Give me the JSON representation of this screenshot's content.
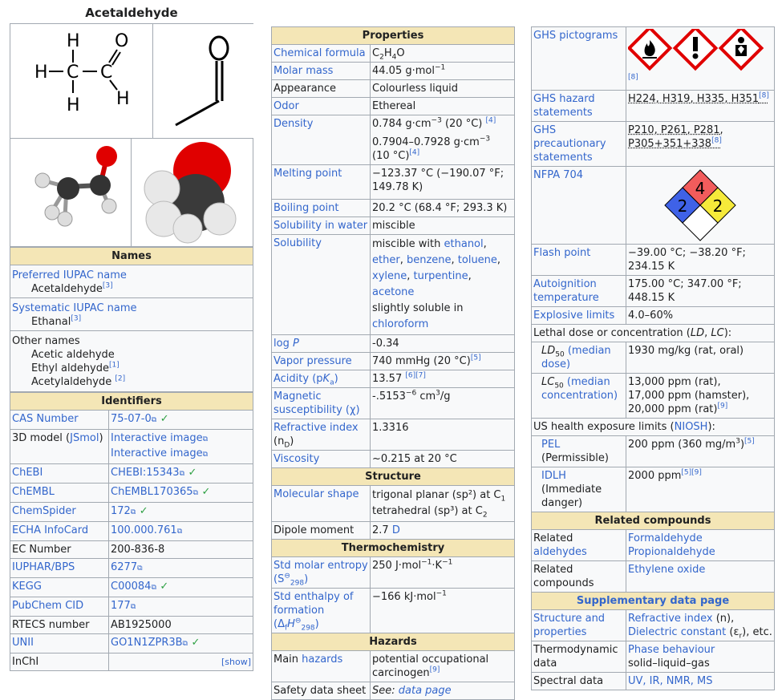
{
  "title": "Acetaldehyde",
  "names": {
    "header": "Names",
    "preferred_label": "Preferred IUPAC name",
    "preferred_value": "Acetaldehyde",
    "preferred_ref": "[3]",
    "systematic_label": "Systematic IUPAC name",
    "systematic_value": "Ethanal",
    "systematic_ref": "[3]",
    "other_label": "Other names",
    "other": [
      {
        "text": "Acetic aldehyde",
        "ref": ""
      },
      {
        "text": "Ethyl aldehyde",
        "ref": "[1]"
      },
      {
        "text": "Acetylaldehyde ",
        "ref": "[2]"
      }
    ]
  },
  "structure_labels": {
    "h1": "H",
    "h2": "H",
    "h3": "H",
    "h4": "H",
    "c1": "C",
    "c2": "C",
    "o": "O"
  },
  "identifiers": {
    "header": "Identifiers",
    "rows": [
      {
        "label": "CAS Number",
        "value": "75-07-0",
        "link": true,
        "check": true
      },
      {
        "label": "3D model (",
        "label_link": "JSmol",
        "label_tail": ")",
        "value": "Interactive image",
        "value2": "Interactive image",
        "link": true,
        "check": false
      },
      {
        "label": "ChEBI",
        "value": "CHEBI:15343",
        "link": true,
        "check": true
      },
      {
        "label": "ChEMBL",
        "value": "ChEMBL170365",
        "link": true,
        "check": true
      },
      {
        "label": "ChemSpider",
        "value": "172",
        "link": true,
        "check": true
      },
      {
        "label": "ECHA InfoCard",
        "value": "100.000.761",
        "link": true,
        "check": false
      },
      {
        "label": "EC Number",
        "value": "200-836-8",
        "link": false,
        "check": false
      },
      {
        "label": "IUPHAR/BPS",
        "value": "6277",
        "link": true,
        "check": false
      },
      {
        "label": "KEGG",
        "value": "C00084",
        "link": true,
        "check": true
      },
      {
        "label": "PubChem CID",
        "value": "177",
        "link": true,
        "check": false
      },
      {
        "label": "RTECS number",
        "value": "AB1925000",
        "link": false,
        "check": false
      },
      {
        "label": "UNII",
        "value": "GO1N1ZPR3B",
        "link": true,
        "check": true
      },
      {
        "label": "InChI",
        "value": "[show]",
        "link": false,
        "check": false
      }
    ]
  },
  "properties": {
    "header": "Properties",
    "formula_label": "Chemical formula",
    "molar_mass_label": "Molar mass",
    "molar_mass": "44.05 g·mol",
    "appearance_label": "Appearance",
    "appearance": "Colourless liquid",
    "odor_label": "Odor",
    "odor": "Ethereal",
    "density_label": "Density",
    "density1": "0.784 g·cm",
    "density1_tail": " (20 °C) ",
    "density1_ref": "[4]",
    "density2": "0.7904–0.7928 g·cm",
    "density2_tail": "(10 °C)",
    "density2_ref": "[4]",
    "melting_label": "Melting point",
    "melting": "−123.37 °C (−190.07 °F; 149.78 K)",
    "boiling_label": "Boiling point",
    "boiling": "20.2 °C (68.4 °F; 293.3 K)",
    "sol_water_label": "Solubility in water",
    "sol_water": "miscible",
    "solubility_label": "Solubility",
    "solubility_prefix": "miscible with ",
    "solvents": [
      "ethanol",
      "ether",
      "benzene",
      "toluene",
      "xylene",
      "turpentine",
      "acetone"
    ],
    "slight_prefix": "slightly soluble in ",
    "slight_link": "chloroform",
    "logp_label": "log ",
    "logp_label_p": "P",
    "logp": "-0.34",
    "vapor_label": "Vapor pressure",
    "vapor": "740 mmHg (20 °C)",
    "vapor_ref": "[5]",
    "acidity_label": "Acidity (p",
    "acidity_k": "K",
    "acidity_a": "a",
    "acidity_close": ")",
    "acidity": "13.57 ",
    "acidity_ref": "[6][7]",
    "mag_label": "Magnetic susceptibility (χ)",
    "mag": "-.5153",
    "mag_exp": "−6",
    "mag_unit": " cm",
    "mag_unit_exp": "3",
    "mag_unit_tail": "/g",
    "refr_label": "Refractive index",
    "refr_sub_label": "(n",
    "refr_sub": "D",
    "refr_close": ")",
    "refr": "1.3316",
    "visc_label": "Viscosity",
    "visc": "~0.215 at 20 °C"
  },
  "structure": {
    "header": "Structure",
    "shape_label": "Molecular shape",
    "shape1": "trigonal planar (sp²) at C",
    "shape1_sub": "1",
    "shape2": "tetrahedral (sp³) at C",
    "shape2_sub": "2",
    "dipole_label": "Dipole moment",
    "dipole": "2.7 ",
    "dipole_unit": "D"
  },
  "thermo": {
    "header": "Thermochemistry",
    "entropy_label": "Std molar entropy (S",
    "entropy_sub": "298",
    "entropy": "250 J·mol",
    "entropy_tail": "·K",
    "enthalpy_label": "Std enthalpy of formation (Δ",
    "enthalpy_sub": "298",
    "enthalpy": "−166 kJ·mol"
  },
  "hazards": {
    "header": "Hazards",
    "main_label": "Main ",
    "main_link": "hazards",
    "main": "potential occupational carcinogen",
    "main_ref": "[9]",
    "sds_label": "Safety data sheet",
    "sds_see": "See: ",
    "sds_link": "data page"
  },
  "ghs": {
    "pict_label": "GHS pictograms",
    "pict_ref": "[8]",
    "hazard_label": "GHS hazard statements",
    "hazard": [
      "H224",
      "H319",
      "H335",
      "H351"
    ],
    "hazard_ref": "[8]",
    "precaution_label": "GHS precautionary statements",
    "precaution": [
      "P210",
      "P261",
      "P281",
      "P305+351+338"
    ],
    "precaution_ref": "[8]",
    "nfpa_label": "NFPA 704",
    "nfpa_health": "2",
    "nfpa_fire": "4",
    "nfpa_reactivity": "2"
  },
  "safety": {
    "flash_label": "Flash point",
    "flash": "−39.00 °C; −38.20 °F; 234.15 K",
    "autoign_label": "Autoignition temperature",
    "autoign": "175.00 °C; 347.00 °F; 448.15 K",
    "explosive_label": "Explosive limits",
    "explosive": "4.0–60%",
    "lethal_header": "Lethal dose or concentration (",
    "lethal_ld": "LD",
    "lethal_sep": ", ",
    "lethal_lc": "LC",
    "lethal_close": "):",
    "ld50_label_a": "LD",
    "ld50_sub": "50",
    "ld50_link": "(median dose)",
    "ld50": "1930 mg/kg (rat, oral)",
    "lc50_label_a": "LC",
    "lc50_sub": "50",
    "lc50_link": "(median concentration)",
    "lc50_lines": [
      "13,000 ppm (rat),",
      "17,000 ppm (hamster),",
      "20,000 ppm (rat)"
    ],
    "lc50_ref": "[9]",
    "us_header": "US health exposure limits (",
    "us_link": "NIOSH",
    "us_close": "):",
    "pel_label": "PEL",
    "pel_desc": "(Permissible)",
    "pel": "200 ppm (360 mg/m",
    "pel_exp": "3",
    "pel_tail": ")",
    "pel_ref": "[5]",
    "idlh_label": "IDLH",
    "idlh_desc": "(Immediate danger)",
    "idlh": "2000 ppm",
    "idlh_ref": "[5][9]"
  },
  "related": {
    "header": "Related compounds",
    "ald_label": "Related ",
    "ald_link": "aldehydes",
    "aldehydes": [
      "Formaldehyde",
      "Propionaldehyde"
    ],
    "comp_label": "Related compounds",
    "compounds": [
      "Ethylene oxide"
    ]
  },
  "supplementary": {
    "header": "Supplementary data page",
    "struct_label": "Structure and properties",
    "struct_val1": "Refractive index",
    "struct_val1_tail": " (n),",
    "struct_val2": "Dielectric constant",
    "struct_val2_tail": " (ε",
    "struct_val2_sub": "r",
    "struct_val2_end": "), etc.",
    "thermo_label": "Thermodynamic data",
    "thermo_val1": "Phase behaviour",
    "thermo_val2": "solid–liquid–gas",
    "spectral_label": "Spectral data",
    "spectral_val": "UV, IR, NMR, MS"
  },
  "colors": {
    "link": "#3366cc",
    "header": "#f4e6b6",
    "border": "#a2a9b1",
    "check": "#2ea043",
    "ghs_red": "#e00000",
    "nfpa_blue": "#3f62e7",
    "nfpa_red": "#f25c5c",
    "nfpa_yellow": "#f6ea3a"
  }
}
